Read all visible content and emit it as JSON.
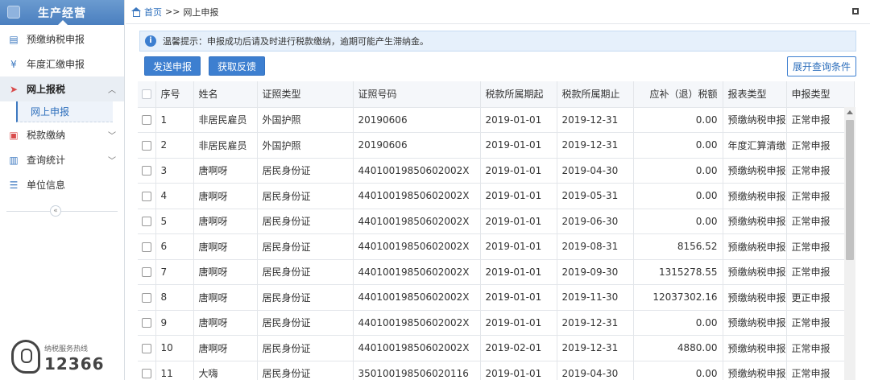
{
  "sidebar": {
    "header_title": "生产经营",
    "items": [
      {
        "label": "预缴纳税申报",
        "icon": "clipboard-icon"
      },
      {
        "label": "年度汇缴申报",
        "icon": "yen-icon"
      },
      {
        "label": "网上报税",
        "icon": "paper-plane-icon"
      },
      {
        "label": "税款缴纳",
        "icon": "monitor-icon"
      },
      {
        "label": "查询统计",
        "icon": "search-doc-icon"
      },
      {
        "label": "单位信息",
        "icon": "list-icon"
      }
    ],
    "sub_item": "网上申报",
    "hotline_label": "纳税服务热线",
    "hotline_number": "12366"
  },
  "breadcrumb": {
    "home": "首页",
    "sep": ">>",
    "current": "网上申报"
  },
  "notice": "温馨提示：申报成功后请及时进行税款缴纳，逾期可能产生滞纳金。",
  "buttons": {
    "send": "发送申报",
    "feedback": "获取反馈",
    "expand": "展开查询条件"
  },
  "table": {
    "headers": [
      "序号",
      "姓名",
      "证照类型",
      "证照号码",
      "税款所属期起",
      "税款所属期止",
      "应补（退）税额",
      "报表类型",
      "申报类型"
    ],
    "rows": [
      [
        "1",
        "非居民雇员",
        "外国护照",
        "20190606",
        "2019-01-01",
        "2019-12-31",
        "0.00",
        "预缴纳税申报",
        "正常申报"
      ],
      [
        "2",
        "非居民雇员",
        "外国护照",
        "20190606",
        "2019-01-01",
        "2019-12-31",
        "0.00",
        "年度汇算清缴",
        "正常申报"
      ],
      [
        "3",
        "唐啊呀",
        "居民身份证",
        "44010019850602002X",
        "2019-01-01",
        "2019-04-30",
        "0.00",
        "预缴纳税申报",
        "正常申报"
      ],
      [
        "4",
        "唐啊呀",
        "居民身份证",
        "44010019850602002X",
        "2019-01-01",
        "2019-05-31",
        "0.00",
        "预缴纳税申报",
        "正常申报"
      ],
      [
        "5",
        "唐啊呀",
        "居民身份证",
        "44010019850602002X",
        "2019-01-01",
        "2019-06-30",
        "0.00",
        "预缴纳税申报",
        "正常申报"
      ],
      [
        "6",
        "唐啊呀",
        "居民身份证",
        "44010019850602002X",
        "2019-01-01",
        "2019-08-31",
        "8156.52",
        "预缴纳税申报",
        "正常申报"
      ],
      [
        "7",
        "唐啊呀",
        "居民身份证",
        "44010019850602002X",
        "2019-01-01",
        "2019-09-30",
        "1315278.55",
        "预缴纳税申报",
        "正常申报"
      ],
      [
        "8",
        "唐啊呀",
        "居民身份证",
        "44010019850602002X",
        "2019-01-01",
        "2019-11-30",
        "12037302.16",
        "预缴纳税申报",
        "更正申报"
      ],
      [
        "9",
        "唐啊呀",
        "居民身份证",
        "44010019850602002X",
        "2019-01-01",
        "2019-12-31",
        "0.00",
        "预缴纳税申报",
        "正常申报"
      ],
      [
        "10",
        "唐啊呀",
        "居民身份证",
        "44010019850602002X",
        "2019-02-01",
        "2019-12-31",
        "4880.00",
        "预缴纳税申报",
        "正常申报"
      ],
      [
        "11",
        "大嗨",
        "居民身份证",
        "350100198506020116",
        "2019-01-01",
        "2019-04-30",
        "0.00",
        "预缴纳税申报",
        "正常申报"
      ]
    ]
  }
}
